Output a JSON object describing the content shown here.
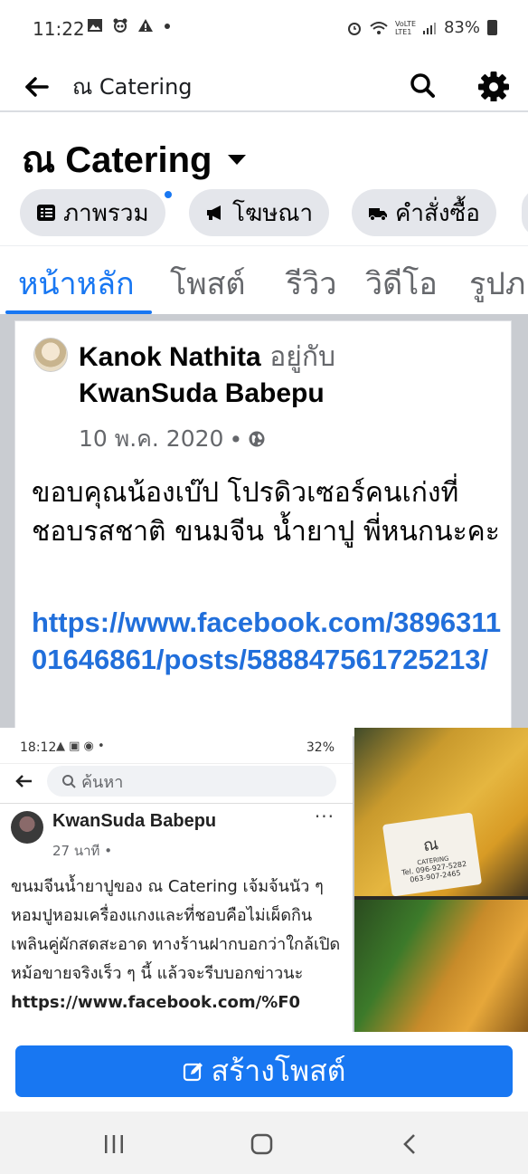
{
  "status_bar": {
    "time": "11:22",
    "left_icons": [
      "image-icon",
      "panda-icon",
      "warning-icon",
      "dot-icon"
    ],
    "network": "VoLTE LTE1",
    "battery": "83%"
  },
  "app_bar": {
    "title": "ณ Catering"
  },
  "page_header": {
    "name": "ณ Catering",
    "chips": [
      {
        "label": "ภาพรวม",
        "icon": "list-icon"
      },
      {
        "label": "โฆษณา",
        "icon": "megaphone-icon"
      },
      {
        "label": "คำสั่งซื้อ",
        "icon": "truck-icon"
      }
    ]
  },
  "tabs": [
    "หน้าหลัก",
    "โพสต์",
    "รีวิว",
    "วิดีโอ",
    "รูปภ"
  ],
  "post": {
    "author": "Kanok Nathita",
    "with_text": " อยู่กับ",
    "tagged": "KwanSuda Babepu",
    "date": "10 พ.ค. 2020",
    "separator": "•",
    "text": "ขอบคุณน้องเบ๊ป โปรดิวเซอร์คนเก่งที่ชอบรสชาติ ขนมจีน น้ำยาปู พี่หนกนะคะ",
    "link": "https://www.facebook.com/389631101646861/posts/588847561725213/"
  },
  "embedded_screenshot": {
    "time": "18:12",
    "battery": "32%",
    "search_placeholder": "ค้นหา",
    "author": "KwanSuda Babepu",
    "more": "···",
    "meta": "27 นาที •",
    "text": "ขนมจีนน้ำยาปูของ  ณ Catering เจ้มจ้นนัว ๆ หอมปูหอมเครื่องแกงและที่ชอบคือไม่เผ็ดกินเพลินคู่ผักสดสะอาด ทางร้านฝากบอกว่าใกล้เปิดหม้อขายจริงเร็ว ๆ นี้ แล้วจะรีบบอกข่าวนะ",
    "link": "https://www.facebook.com/%F0"
  },
  "food_label": {
    "logo": "ณ",
    "logo_sub": "CATERING",
    "tel1": "Tel. 096-927-5282",
    "tel2": "063-907-2465"
  },
  "create_post": {
    "label": "สร้างโพสต์"
  },
  "colors": {
    "accent": "#1877f2",
    "link": "#216fdb",
    "chip_bg": "#e4e6eb"
  }
}
